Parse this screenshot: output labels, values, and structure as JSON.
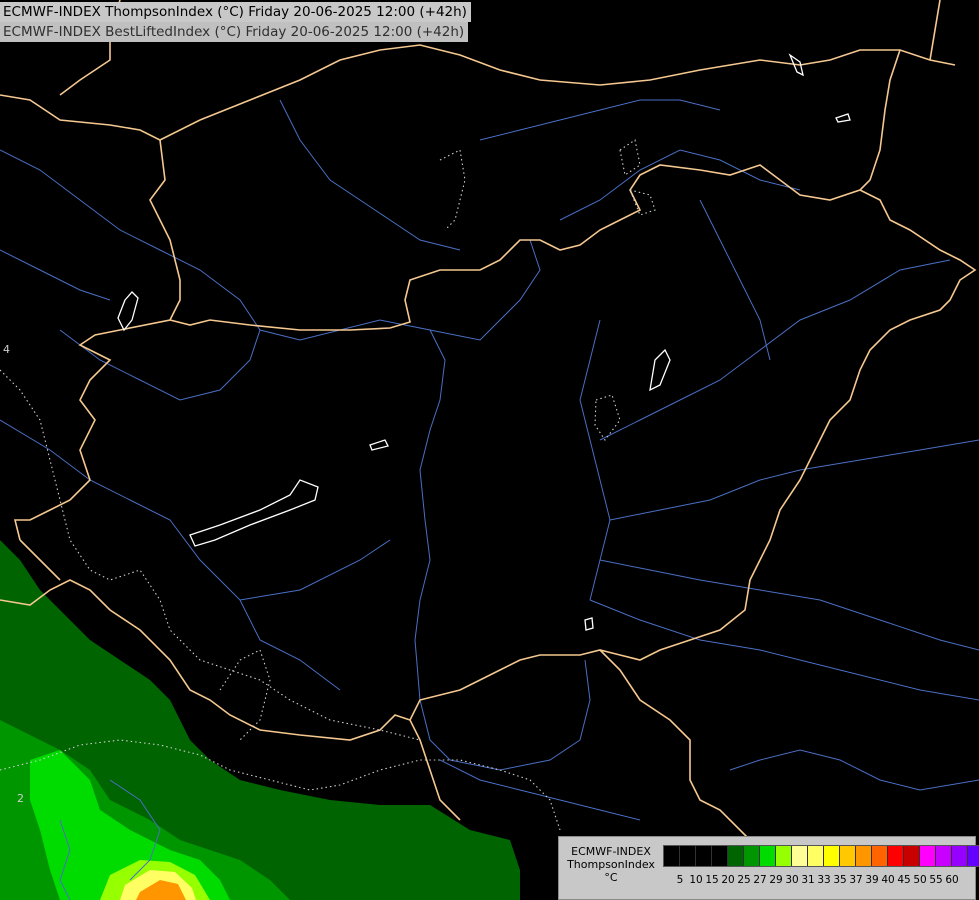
{
  "titles": {
    "line1": "ECMWF-INDEX ThompsonIndex (°C) Friday 20-06-2025 12:00 (+42h)",
    "line2": "ECMWF-INDEX BestLiftedIndex (°C) Friday 20-06-2025 12:00 (+42h)"
  },
  "map": {
    "background": "#000000",
    "border_color": "#f5c890",
    "river_color": "#4a6fc4",
    "lake_outline_color": "#ffffff",
    "contour_color": "#cfcfcf",
    "contour_labels": [
      "4",
      "2"
    ],
    "fill_colors": {
      "dark_green": "#006400",
      "green": "#009600",
      "bright_green": "#00dc00",
      "lime": "#96ff00",
      "yellow": "#ffff64",
      "orange": "#ff9600"
    }
  },
  "legend": {
    "model": "ECMWF-INDEX",
    "parameter": "ThompsonIndex",
    "unit": "°C",
    "colors": [
      "#000000",
      "#000000",
      "#000000",
      "#000000",
      "#006400",
      "#009600",
      "#00dc00",
      "#96ff00",
      "#ffff96",
      "#ffff64",
      "#ffff00",
      "#ffc800",
      "#ff9600",
      "#ff6400",
      "#ff0000",
      "#c80000",
      "#ff00ff",
      "#c800ff",
      "#9600ff",
      "#6400ff",
      "#0000ff"
    ],
    "ticks": [
      "5",
      "10",
      "15",
      "20",
      "25",
      "27",
      "29",
      "30",
      "31",
      "33",
      "35",
      "37",
      "39",
      "40",
      "45",
      "50",
      "55",
      "60"
    ]
  }
}
